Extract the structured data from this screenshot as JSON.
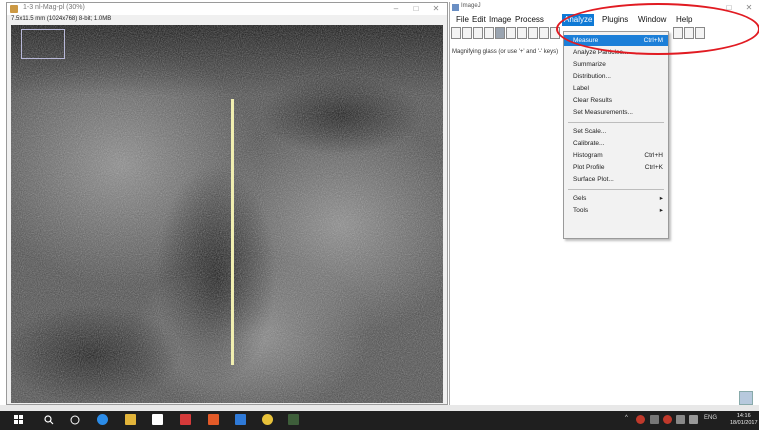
{
  "image_window": {
    "title": "1-3 nl-Mag-pl (30%)",
    "info": "7.5x11.5 mm (1024x768) 8-bit; 1.0MB",
    "controls": [
      "–",
      "□",
      "✕"
    ]
  },
  "imagej": {
    "title": "ImageJ",
    "menus": [
      "File",
      "Edit",
      "Image",
      "Process",
      "Analyze",
      "Plugins",
      "Window",
      "Help"
    ],
    "status": "Magnifying glass (or use '+' and '-' keys)",
    "controls": [
      "–",
      "□",
      "✕"
    ]
  },
  "analyze_menu": {
    "items": [
      {
        "label": "Measure",
        "shortcut": "Ctrl+M",
        "highlighted": true
      },
      {
        "label": "Analyze Particles...",
        "shortcut": ""
      },
      {
        "label": "Summarize",
        "shortcut": ""
      },
      {
        "label": "Distribution...",
        "shortcut": ""
      },
      {
        "label": "Label",
        "shortcut": ""
      },
      {
        "label": "Clear Results",
        "shortcut": ""
      },
      {
        "label": "Set Measurements...",
        "shortcut": ""
      },
      {
        "separator": true
      },
      {
        "label": "Set Scale...",
        "shortcut": ""
      },
      {
        "label": "Calibrate...",
        "shortcut": ""
      },
      {
        "label": "Histogram",
        "shortcut": "Ctrl+H"
      },
      {
        "label": "Plot Profile",
        "shortcut": "Ctrl+K"
      },
      {
        "label": "Surface Plot...",
        "shortcut": ""
      },
      {
        "separator": true
      },
      {
        "label": "Gels",
        "shortcut": "▸"
      },
      {
        "label": "Tools",
        "shortcut": "▸"
      }
    ]
  },
  "taskbar": {
    "clock_time": "14:16",
    "clock_date": "18/01/2017",
    "tray_lang": "ENG"
  },
  "colors": {
    "menu_highlight": "#1c7fd8",
    "annotation": "#e11b22",
    "line_selection": "#f1efb0"
  },
  "icons": [
    "windows-start-icon",
    "search-icon",
    "task-view-icon",
    "edge-icon",
    "explorer-icon",
    "store-icon",
    "mail-icon",
    "office-icon",
    "chrome-icon",
    "imagej-icon"
  ]
}
